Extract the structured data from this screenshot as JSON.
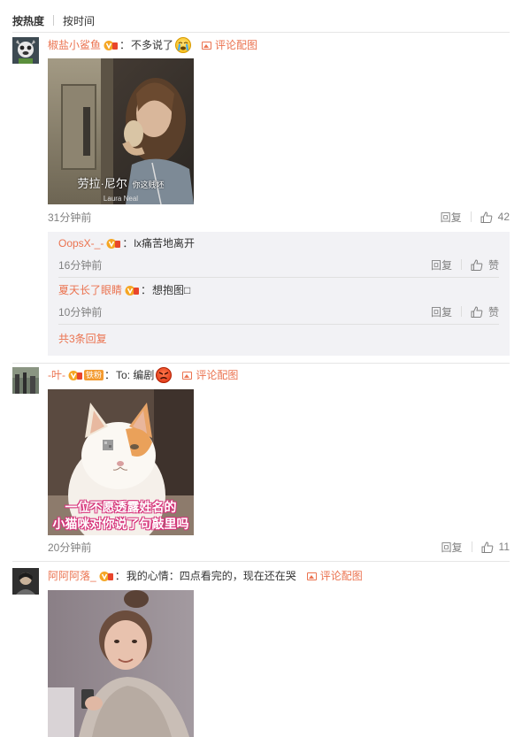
{
  "sort": {
    "hot": "按热度",
    "time": "按时间"
  },
  "pic_link_label": "评论配图",
  "reply_label": "回复",
  "colors": {
    "username": "#eb7350",
    "muted": "#808080",
    "reply_bg": "#f2f2f5"
  },
  "comments": [
    {
      "username": "椒盐小鲨鱼",
      "text": "不多说了",
      "time": "31分钟前",
      "likes": "42",
      "image_caption": {
        "name": "劳拉·尼尔",
        "sub": "你这贱坯",
        "en": "Laura Neal"
      },
      "replies": [
        {
          "username": "OopsX-_-",
          "text": "lx痛苦地离开",
          "time": "16分钟前",
          "likes": "赞"
        },
        {
          "username": "夏天长了眼睛",
          "text": "想抱图□",
          "time": "10分钟前",
          "likes": "赞"
        }
      ],
      "more_replies": "共3条回复"
    },
    {
      "username": "-叶-",
      "fan_badge": "铁粉",
      "text": "To: 编剧",
      "time": "20分钟前",
      "likes": "11",
      "image_caption": {
        "line1": "一位不愿透露姓名的",
        "line2": "小猫咪对你说了句敲里吗"
      }
    },
    {
      "username": "阿阿阿落_",
      "text": "我的心情：四点看完的，现在还在哭"
    }
  ]
}
